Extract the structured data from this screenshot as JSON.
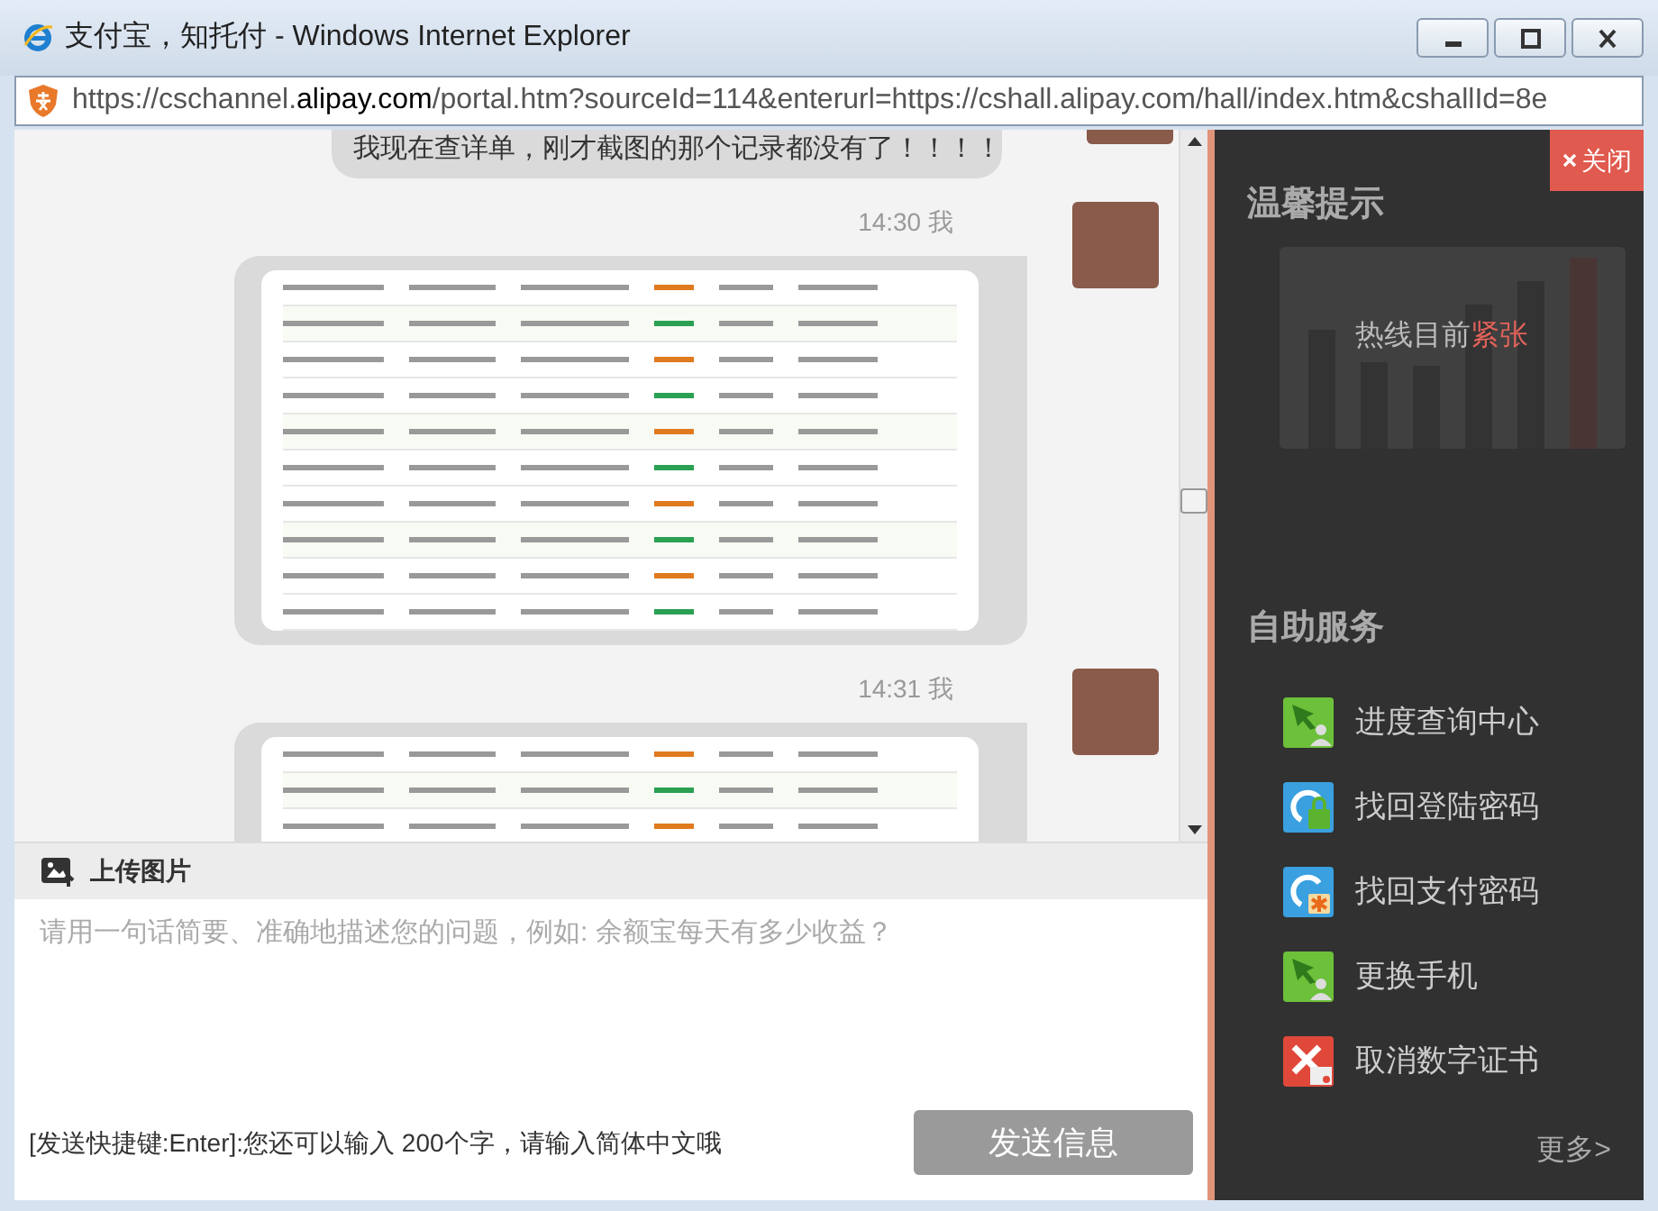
{
  "window": {
    "title": "支付宝，知托付 - Windows Internet Explorer"
  },
  "address_bar": {
    "url_start": "https://cschannel.",
    "url_domain": "alipay.com",
    "url_end": "/portal.htm?sourceId=114&enterurl=https://cshall.alipay.com/hall/index.htm&cshallId=8e"
  },
  "chat": {
    "messages": [
      {
        "kind": "text",
        "text": "我现在查详单，刚才截图的那个记录都没有了！！！！"
      },
      {
        "kind": "image",
        "time": "14:30 我"
      },
      {
        "kind": "image",
        "time": "14:31 我"
      }
    ]
  },
  "upload": {
    "label": "上传图片"
  },
  "input": {
    "placeholder": "请用一句话简要、准确地描述您的问题，例如: 余额宝每天有多少收益？"
  },
  "footer": {
    "hint": "[发送快捷键:Enter]:您还可以输入 200个字，请输入简体中文哦",
    "send_button": "发送信息"
  },
  "side_panel": {
    "close_label": "关闭",
    "tip_title": "温馨提示",
    "hotline_text": "热线目前",
    "hotline_status": "紧张",
    "services_title": "自助服务",
    "services": [
      {
        "kind": "progress",
        "label": "进度查询中心"
      },
      {
        "kind": "lock",
        "label": "找回登陆密码"
      },
      {
        "kind": "key",
        "label": "找回支付密码"
      },
      {
        "kind": "progress",
        "label": "更换手机"
      },
      {
        "kind": "cancel",
        "label": "取消数字证书"
      }
    ],
    "more": "更多>"
  }
}
